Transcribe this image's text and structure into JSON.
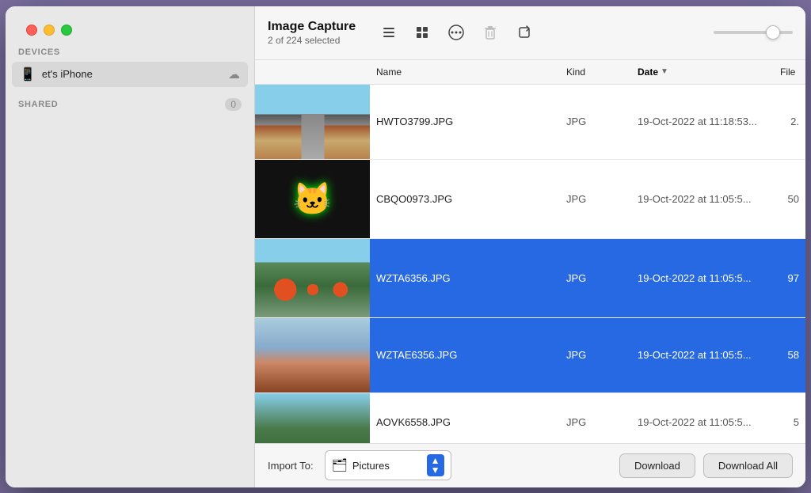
{
  "window": {
    "title": "Image Capture",
    "subtitle": "2 of 224 selected"
  },
  "sidebar": {
    "devices_label": "DEVICES",
    "device": {
      "name": "et's iPhone",
      "icon": "📱"
    },
    "shared_label": "SHARED",
    "shared_count": "0"
  },
  "toolbar": {
    "list_view_label": "List View",
    "grid_view_label": "Grid View",
    "more_label": "More",
    "delete_label": "Delete",
    "rotate_label": "Rotate"
  },
  "table": {
    "headers": {
      "name": "Name",
      "kind": "Kind",
      "date": "Date",
      "file": "File"
    },
    "rows": [
      {
        "id": "row1",
        "name": "HWTO3799.JPG",
        "kind": "JPG",
        "date": "19-Oct-2022 at 11:18:53...",
        "file": "2.",
        "selected": false,
        "thumb_type": "road",
        "height": "95"
      },
      {
        "id": "row2",
        "name": "CBQO0973.JPG",
        "kind": "JPG",
        "date": "19-Oct-2022 at 11:05:5...",
        "file": "50",
        "selected": false,
        "thumb_type": "cat",
        "height": "100"
      },
      {
        "id": "row3",
        "name": "WZTA6356.JPG",
        "kind": "JPG",
        "date": "19-Oct-2022 at 11:05:5...",
        "file": "97",
        "selected": true,
        "thumb_type": "flowers",
        "height": "100"
      },
      {
        "id": "row4",
        "name": "WZTAE6356.JPG",
        "kind": "JPG",
        "date": "19-Oct-2022 at 11:05:5...",
        "file": "58",
        "selected": true,
        "thumb_type": "blur",
        "height": "95"
      },
      {
        "id": "row5",
        "name": "AOVK6558.JPG",
        "kind": "JPG",
        "date": "19-Oct-2022 at 11:05:5...",
        "file": "5",
        "selected": false,
        "thumb_type": "trees",
        "height": "75"
      }
    ]
  },
  "footer": {
    "import_label": "Import To:",
    "destination": "Pictures",
    "download_label": "Download",
    "download_all_label": "Download All"
  }
}
